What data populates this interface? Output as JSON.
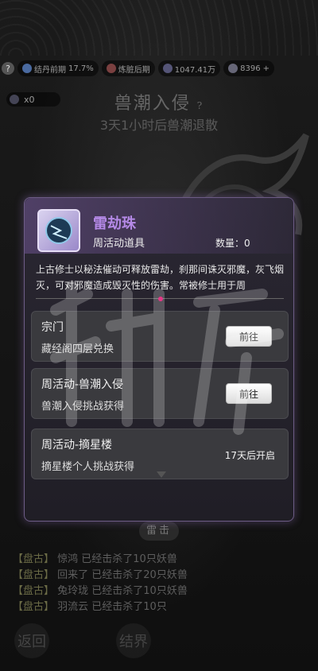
{
  "topbar": {
    "help": "?",
    "realm1": "结丹前期",
    "realm1_pct": "17.7%",
    "realm2": "炼脏后期",
    "power": "1047.41万",
    "coins": "8396",
    "plus": "+"
  },
  "counter": {
    "value": "x0"
  },
  "event": {
    "title": "兽潮入侵",
    "help": "?",
    "subtitle": "3天1小时后兽潮退散"
  },
  "dialog": {
    "item_name": "雷劫珠",
    "item_type": "周活动道具",
    "quantity_label": "数量：0",
    "description": "上古修士以秘法催动可释放雷劫，刹那间诛灭邪魔，灰飞烟灭，可对邪魔造成毁灭性的伤害。常被修士用于周",
    "sources": [
      {
        "title": "宗门",
        "subtitle": "藏经阁四层兑换",
        "action": "前往"
      },
      {
        "title": "周活动-兽潮入侵",
        "subtitle": "兽潮入侵挑战获得",
        "action": "前往"
      },
      {
        "title": "周活动-摘星楼",
        "subtitle": "摘星楼个人挑战获得",
        "status": "17天后开启"
      }
    ]
  },
  "bottom": {
    "attack_button": "雷击",
    "log": [
      {
        "tag": "【盘古】",
        "text": "惊鸿 已经击杀了10只妖兽"
      },
      {
        "tag": "【盘古】",
        "text": "回来了 已经击杀了20只妖兽"
      },
      {
        "tag": "【盘古】",
        "text": "兔玲珑 已经击杀了10只妖兽"
      },
      {
        "tag": "【盘古】",
        "text": "羽流云 已经击杀了10只"
      }
    ],
    "back_button": "返回",
    "result_button": "结界"
  },
  "colors": {
    "accent_purple": "#b489e6",
    "dialog_border": "#6d5c86"
  }
}
